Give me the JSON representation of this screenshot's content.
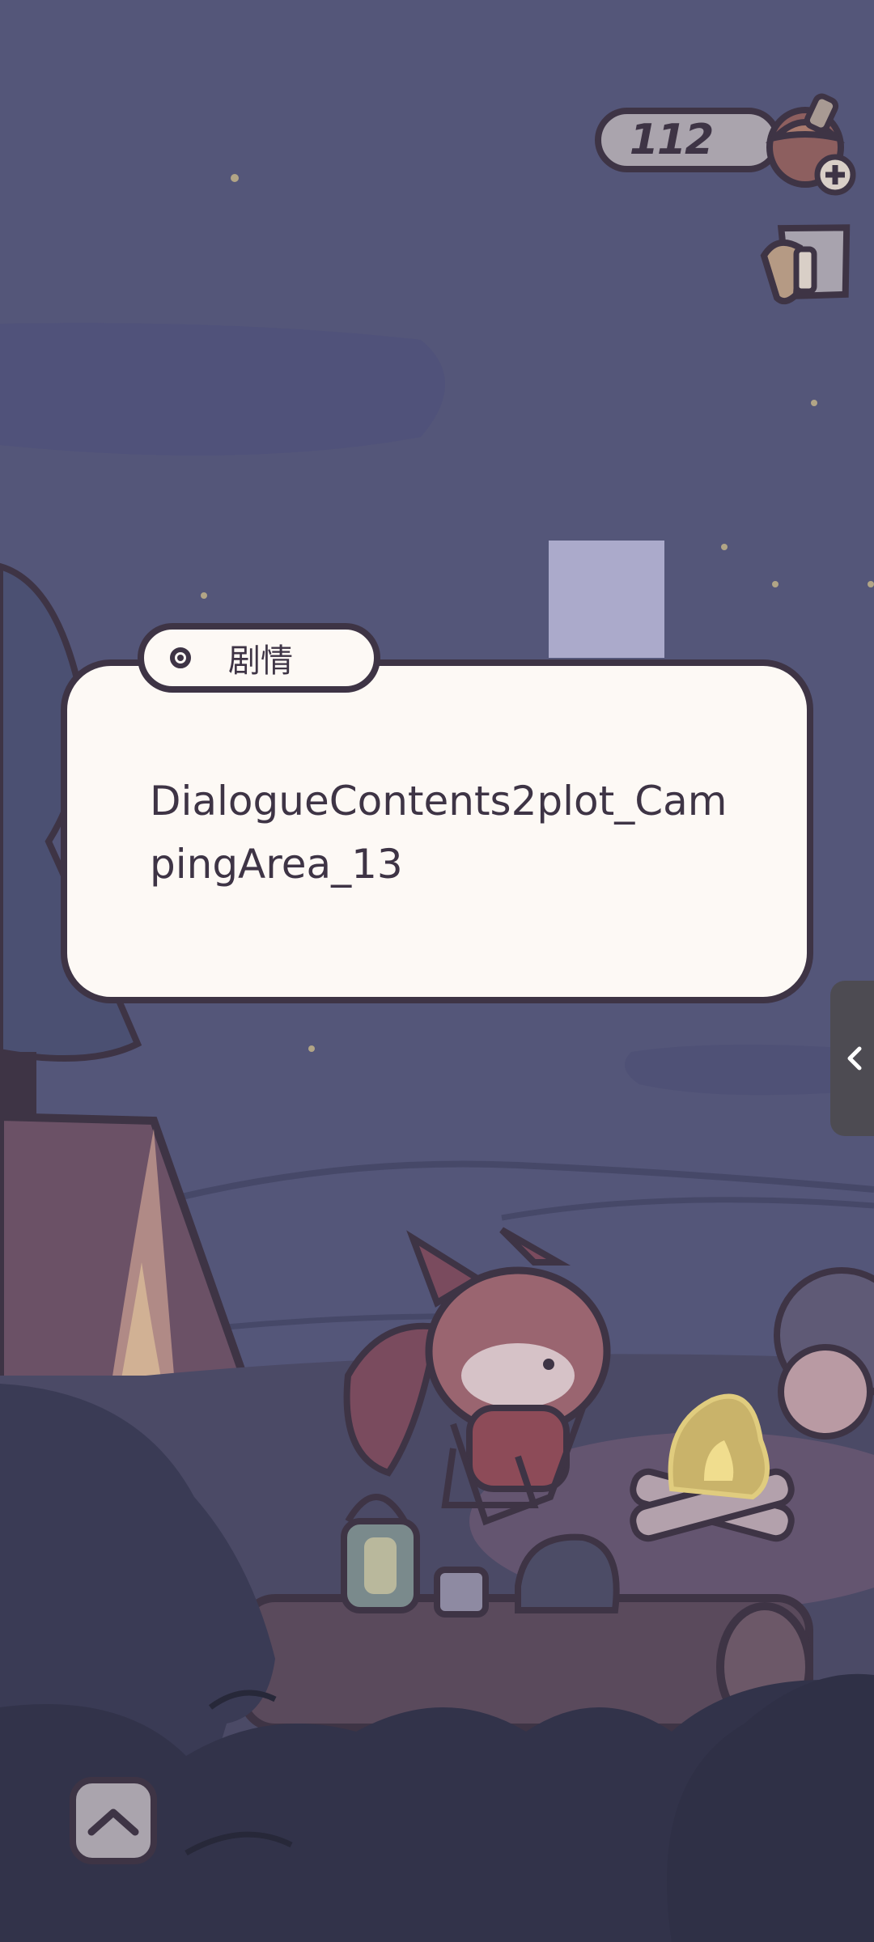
{
  "hud": {
    "currency_value": "112",
    "acorn_icon": "acorn-plus-icon",
    "flag_icon": "flag-icon"
  },
  "dialog": {
    "tab_label": "剧情",
    "text": "DialogueContents2plot_CampingArea_13"
  },
  "colors": {
    "sky": "#545679",
    "outline": "#3e3445",
    "dialog_bg": "#fdf9f5",
    "ui_grey": "#aaa4ad",
    "debug_rect": "#abaacb",
    "drawer": "#4d4b52"
  }
}
